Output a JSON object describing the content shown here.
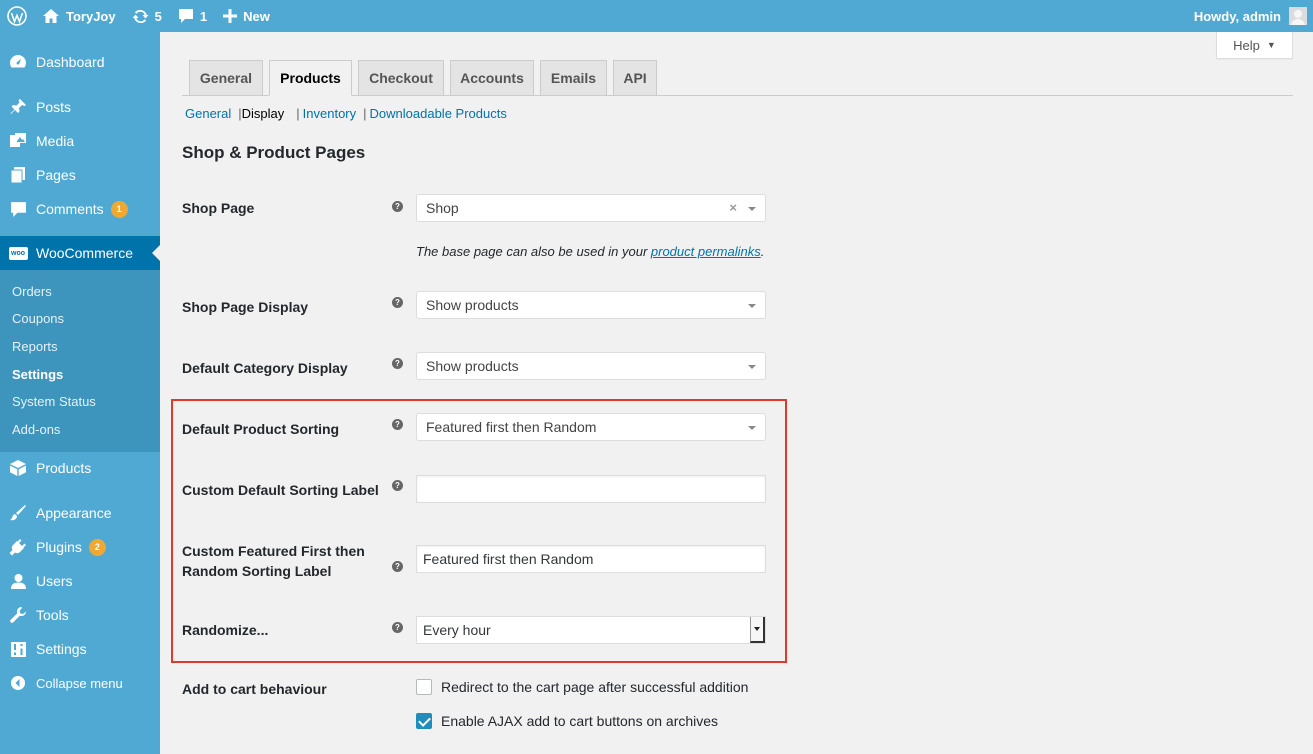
{
  "adminbar": {
    "site_name": "ToryJoy",
    "updates_count": "5",
    "comments_count": "1",
    "new_label": "New",
    "howdy": "Howdy, admin"
  },
  "sidebar": {
    "items": [
      {
        "label": "Dashboard",
        "icon": "dashboard-icon"
      },
      {
        "label": "Posts",
        "icon": "pin-icon"
      },
      {
        "label": "Media",
        "icon": "media-icon"
      },
      {
        "label": "Pages",
        "icon": "pages-icon"
      },
      {
        "label": "Comments",
        "icon": "comment-icon",
        "badge": "1"
      },
      {
        "label": "WooCommerce",
        "icon": "woocommerce-icon",
        "logo_text": "woo"
      },
      {
        "label": "Products",
        "icon": "box-icon"
      },
      {
        "label": "Appearance",
        "icon": "brush-icon"
      },
      {
        "label": "Plugins",
        "icon": "plugin-icon",
        "badge": "2"
      },
      {
        "label": "Users",
        "icon": "user-icon"
      },
      {
        "label": "Tools",
        "icon": "wrench-icon"
      },
      {
        "label": "Settings",
        "icon": "settings-icon"
      },
      {
        "label": "Collapse menu",
        "icon": "collapse-icon"
      }
    ],
    "submenu": [
      "Orders",
      "Coupons",
      "Reports",
      "Settings",
      "System Status",
      "Add-ons"
    ]
  },
  "help_label": "Help",
  "tabs": [
    "General",
    "Products",
    "Checkout",
    "Accounts",
    "Emails",
    "API"
  ],
  "subtabs": [
    "General",
    "Display",
    "Inventory",
    "Downloadable Products"
  ],
  "section_title": "Shop & Product Pages",
  "fields": {
    "shop_page": {
      "label": "Shop Page",
      "value": "Shop"
    },
    "desc_prefix": "The base page can also be used in your ",
    "desc_link": "product permalinks",
    "desc_suffix": ".",
    "shop_page_display": {
      "label": "Shop Page Display",
      "value": "Show products"
    },
    "default_category_display": {
      "label": "Default Category Display",
      "value": "Show products"
    },
    "default_product_sorting": {
      "label": "Default Product Sorting",
      "value": "Featured first then Random"
    },
    "custom_default_sorting_label": {
      "label": "Custom Default Sorting Label",
      "value": ""
    },
    "custom_featured_label": {
      "label_line1": "Custom Featured First then",
      "label_line2": "Random Sorting Label",
      "value": "Featured first then Random"
    },
    "randomize": {
      "label": "Randomize...",
      "value": "Every hour"
    },
    "add_to_cart": {
      "label": "Add to cart behaviour",
      "option1": {
        "label": "Redirect to the cart page after successful addition",
        "checked": false
      },
      "option2": {
        "label": "Enable AJAX add to cart buttons on archives",
        "checked": true
      }
    }
  },
  "tip_glyph": "?",
  "clear_glyph": "×"
}
